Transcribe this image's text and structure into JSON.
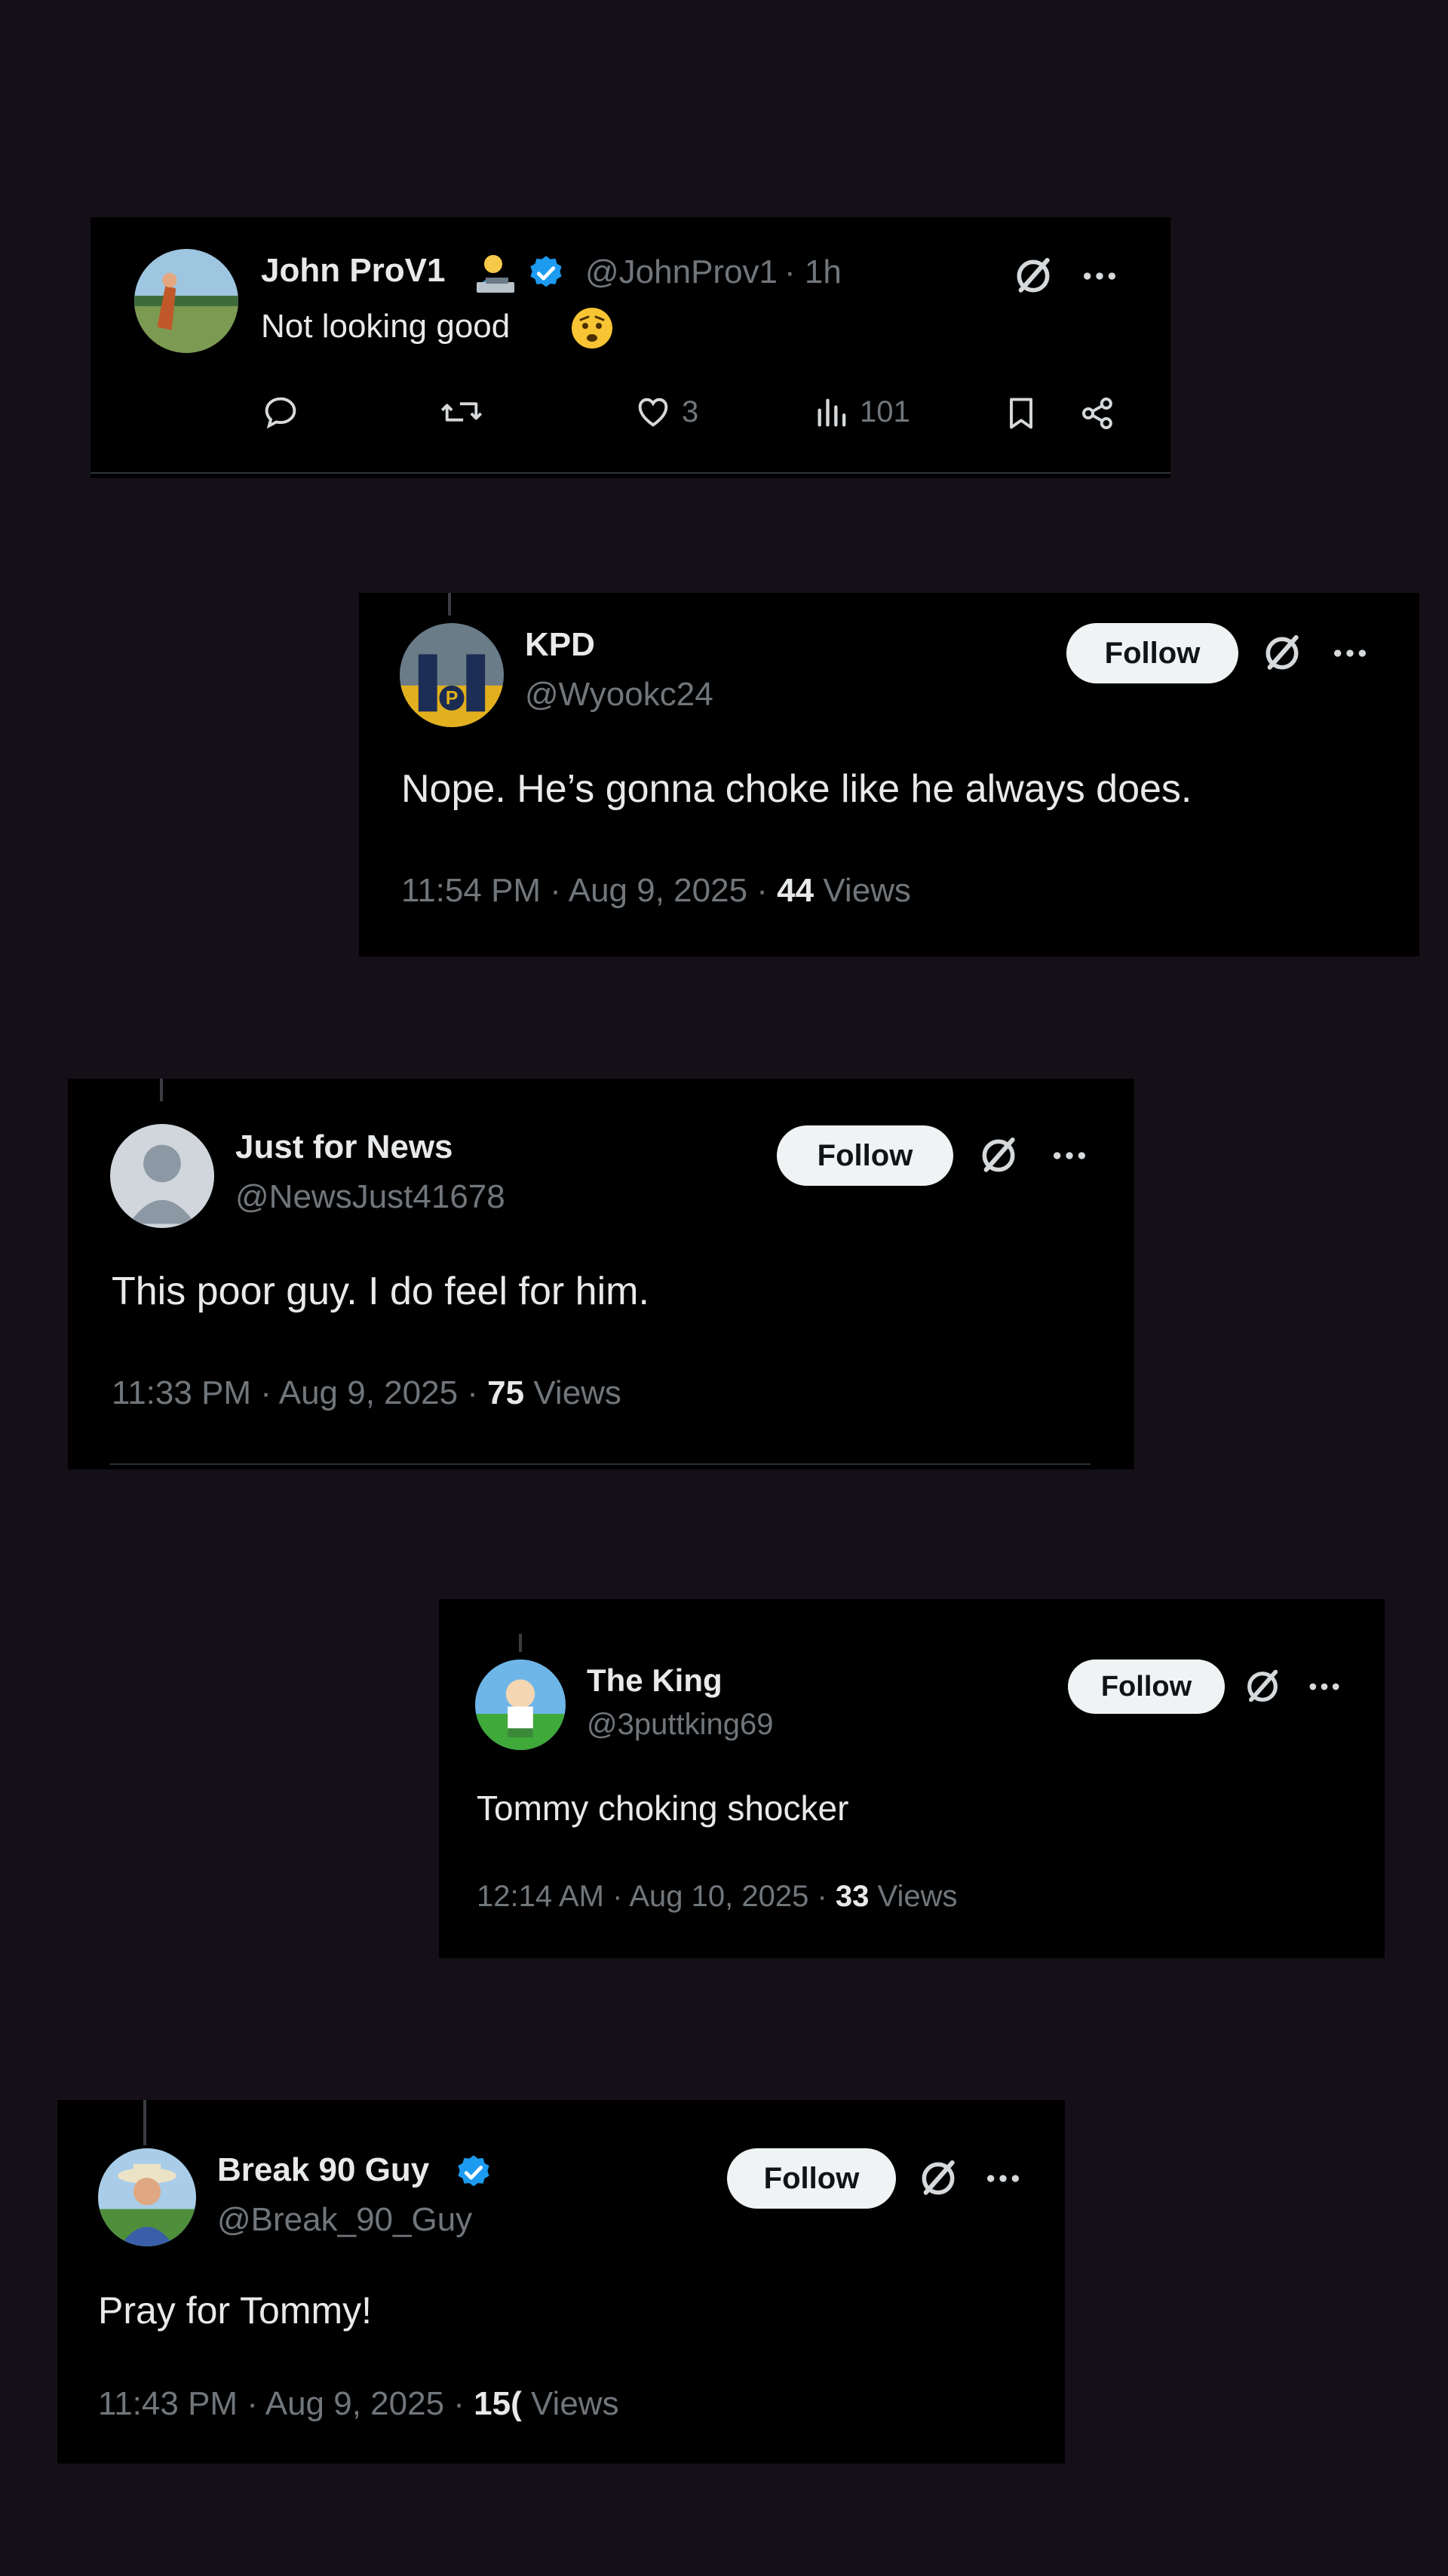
{
  "tweets": [
    {
      "name": "John ProV1",
      "handle": "@JohnProv1",
      "time": "· 1h",
      "text": "Not looking good",
      "emoji_icon": "worried-face-icon",
      "badge_icon": "person-at-laptop-emoji-icon",
      "actions": {
        "replies": "",
        "reposts": "",
        "likes": "3",
        "views": "101"
      }
    },
    {
      "name": "KPD",
      "handle": "@Wyookc24",
      "text": "Nope. He’s gonna choke like he always does.",
      "follow": "Follow",
      "time": "11:54 PM · Aug 9, 2025 · ",
      "views_count": "44",
      "views_label": "Views"
    },
    {
      "name": "Just for News",
      "handle": "@NewsJust41678",
      "text": "This poor guy. I do feel for him.",
      "follow": "Follow",
      "time": "11:33 PM · Aug 9, 2025 · ",
      "views_count": "75",
      "views_label": "Views"
    },
    {
      "name": "The King",
      "handle": "@3puttking69",
      "text": "Tommy choking shocker",
      "follow": "Follow",
      "time": "12:14 AM · Aug 10, 2025 · ",
      "views_count": "33",
      "views_label": "Views"
    },
    {
      "name": "Break 90 Guy",
      "handle": "@Break_90_Guy",
      "text": "Pray for Tommy!",
      "follow": "Follow",
      "time": "11:43 PM · Aug 9, 2025 · ",
      "views_count": "15(",
      "views_label": "Views"
    }
  ],
  "colors": {
    "background": "#150f17",
    "card": "#000000",
    "text": "#e7e9ea",
    "muted": "#71767b",
    "verified": "#1d9bf0",
    "follow_bg": "#eff3f4"
  }
}
